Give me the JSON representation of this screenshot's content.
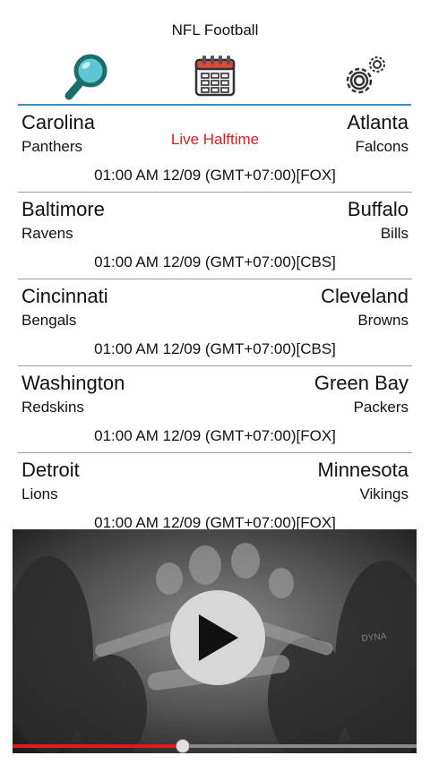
{
  "app": {
    "title": "NFL Football"
  },
  "toolbar": {
    "search_icon": "search-icon",
    "calendar_icon": "calendar-icon",
    "settings_icon": "gear-icon"
  },
  "colors": {
    "accent": "#3c8fc3",
    "live": "#d42020",
    "progress": "#e01b1b"
  },
  "games": [
    {
      "home_city": "Carolina",
      "home_nick": "Panthers",
      "away_city": "Atlanta",
      "away_nick": "Falcons",
      "status": "Live Halftime",
      "time": "01:00 AM 12/09 (GMT+07:00)[FOX]"
    },
    {
      "home_city": "Baltimore",
      "home_nick": "Ravens",
      "away_city": "Buffalo",
      "away_nick": "Bills",
      "status": "",
      "time": "01:00 AM 12/09 (GMT+07:00)[CBS]"
    },
    {
      "home_city": "Cincinnati",
      "home_nick": "Bengals",
      "away_city": "Cleveland",
      "away_nick": "Browns",
      "status": "",
      "time": "01:00 AM 12/09 (GMT+07:00)[CBS]"
    },
    {
      "home_city": "Washington",
      "home_nick": "Redskins",
      "away_city": "Green Bay",
      "away_nick": "Packers",
      "status": "",
      "time": "01:00 AM 12/09 (GMT+07:00)[FOX]"
    },
    {
      "home_city": "Detroit",
      "home_nick": "Lions",
      "away_city": "Minnesota",
      "away_nick": "Vikings",
      "status": "",
      "time": "01:00 AM 12/09 (GMT+07:00)[FOX]"
    }
  ],
  "video": {
    "play_icon": "play-icon",
    "progress_fraction": 0.42
  }
}
